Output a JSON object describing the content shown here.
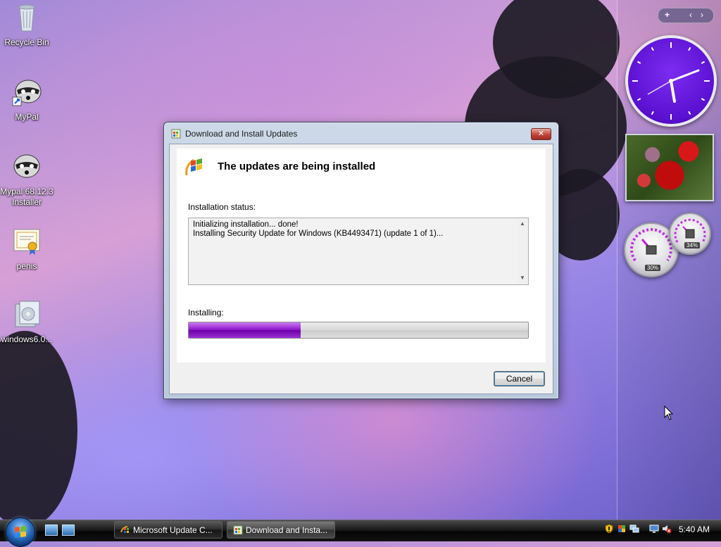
{
  "desktop": {
    "icons": [
      {
        "label": "Recycle Bin"
      },
      {
        "label": "MyPal"
      },
      {
        "label": "Mypal 68.12.3 Installer"
      },
      {
        "label": "penis"
      },
      {
        "label": "windows6.0..."
      }
    ]
  },
  "dialog": {
    "title": "Download and Install Updates",
    "close_label": "✕",
    "heading": "The updates are being installed",
    "status_label": "Installation status:",
    "status_lines": [
      "Initializing installation... done!",
      "Installing Security Update for Windows (KB4493471) (update 1 of 1)..."
    ],
    "installing_label": "Installing:",
    "progress_fraction": 0.33,
    "cancel_label": "Cancel"
  },
  "gadgets": {
    "sidebar_add": "+",
    "sidebar_prev": "‹",
    "sidebar_next": "›",
    "cpu_meter_value": "30%",
    "mem_meter_value": "34%"
  },
  "taskbar": {
    "buttons": [
      {
        "label": "Microsoft Update C..."
      },
      {
        "label": "Download and Insta..."
      }
    ],
    "clock": "5:40 AM"
  },
  "colors": {
    "progress_fill": "#8a12c8",
    "clock_face": "#5a10d0"
  }
}
